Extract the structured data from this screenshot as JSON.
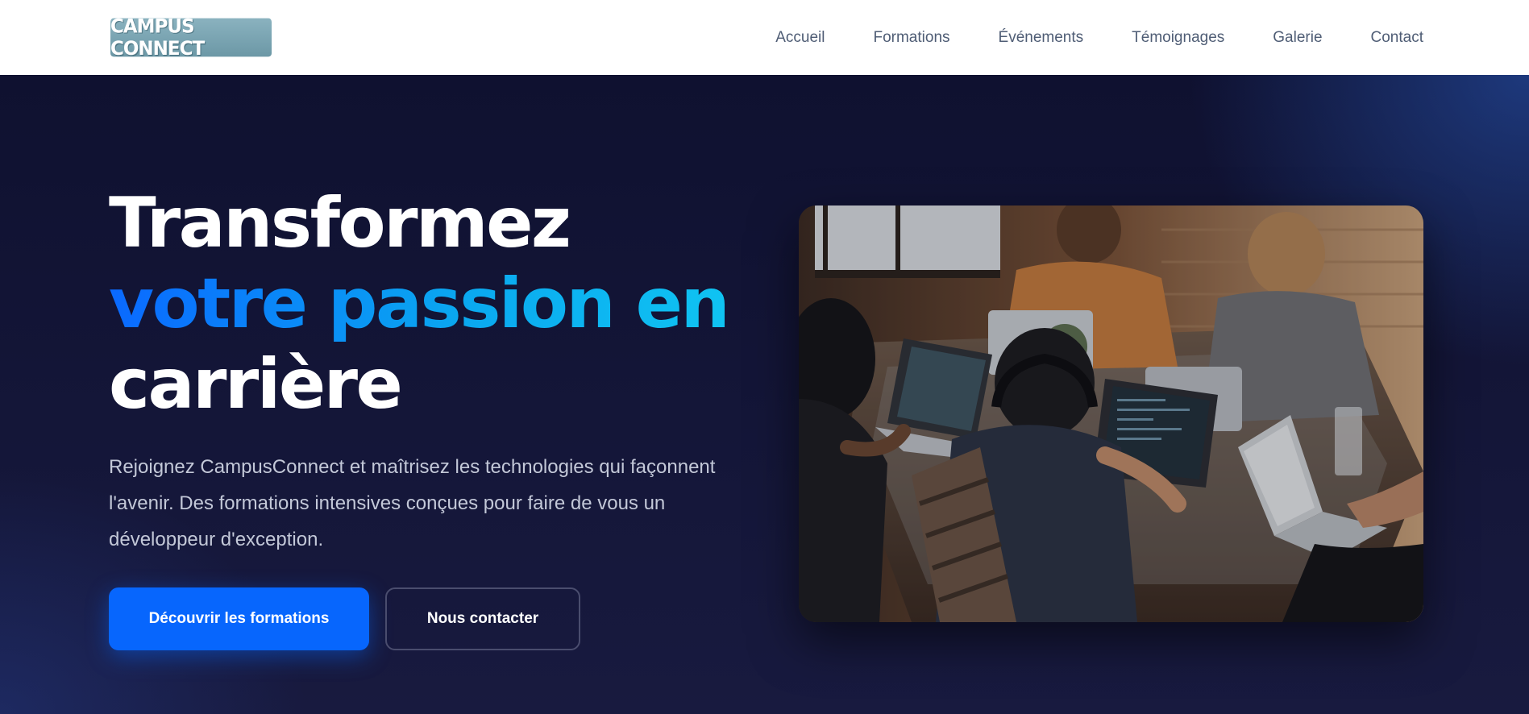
{
  "header": {
    "logo_text": "CAMPUS CONNECT",
    "nav": [
      {
        "label": "Accueil"
      },
      {
        "label": "Formations"
      },
      {
        "label": "Événements"
      },
      {
        "label": "Témoignages"
      },
      {
        "label": "Galerie"
      },
      {
        "label": "Contact"
      }
    ]
  },
  "hero": {
    "title_line1": "Transformez",
    "title_line2": "votre passion en",
    "title_line3": "carrière",
    "subtitle": "Rejoignez CampusConnect et maîtrisez les technologies qui façonnent l'avenir. Des formations intensives conçues pour faire de vous un développeur d'exception.",
    "primary_cta": "Découvrir les formations",
    "secondary_cta": "Nous contacter",
    "image_icon": "photo-students-coding-icon"
  },
  "colors": {
    "accent": "#0766fd",
    "gradient_start": "#0a69ff",
    "gradient_end": "#10c6f2",
    "hero_bg": "#14163a",
    "nav_text": "#4f5d75"
  }
}
